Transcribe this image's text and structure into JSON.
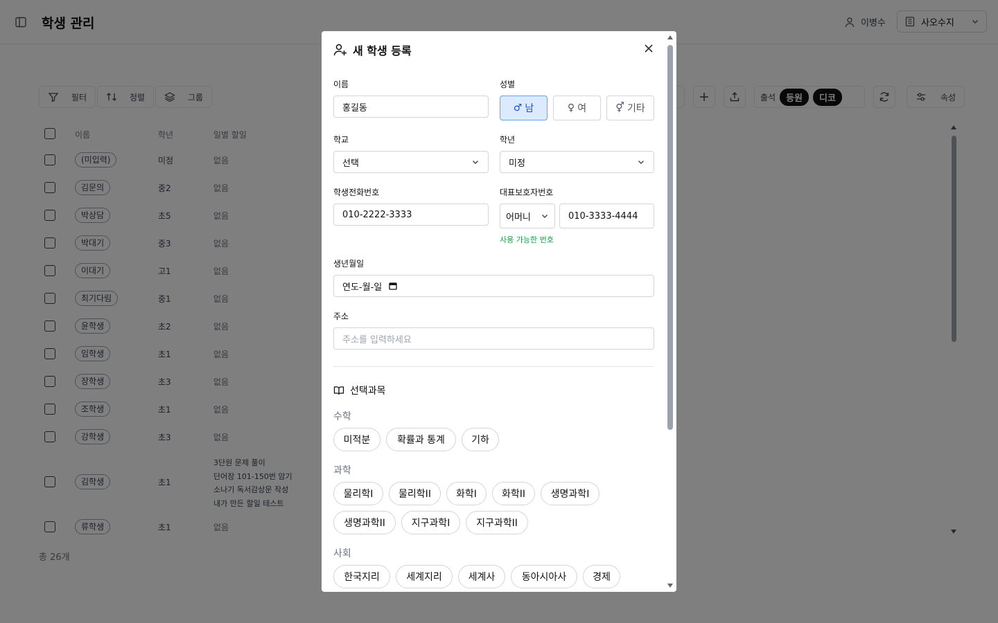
{
  "app": {
    "page_title": "학생 관리",
    "user_name": "이병수",
    "org_name": "사오수지"
  },
  "toolbar": {
    "filter": "필터",
    "sort": "정렬",
    "group": "그룹",
    "attendance": "출석",
    "pill_enroll": "등원",
    "pill_code": "디코",
    "properties": "속성"
  },
  "grid": {
    "headers": {
      "name": "이름",
      "grade": "학년",
      "daily_task": "일별 할일"
    },
    "rows": [
      {
        "name": "(미입력)",
        "grade": "미정",
        "task": "없음"
      },
      {
        "name": "김문의",
        "grade": "중2",
        "task": "없음"
      },
      {
        "name": "박상담",
        "grade": "초5",
        "task": "없음"
      },
      {
        "name": "박대기",
        "grade": "중3",
        "task": "없음"
      },
      {
        "name": "이대기",
        "grade": "고1",
        "task": "없음"
      },
      {
        "name": "최기다림",
        "grade": "중1",
        "task": "없음"
      },
      {
        "name": "윤학생",
        "grade": "초2",
        "task": "없음"
      },
      {
        "name": "임학생",
        "grade": "초1",
        "task": "없음"
      },
      {
        "name": "장학생",
        "grade": "초3",
        "task": "없음"
      },
      {
        "name": "조학생",
        "grade": "초1",
        "task": "없음"
      },
      {
        "name": "강학생",
        "grade": "초3",
        "task": "없음"
      },
      {
        "name": "김학생",
        "grade": "초1",
        "tasks": [
          "3단원 문제 풀이",
          "단어장 101-150번 암기",
          "소나기 독서감상문 작성",
          "내가 만든 할일 테스트"
        ]
      },
      {
        "name": "류학생",
        "grade": "초1",
        "task": "없음"
      }
    ],
    "total": "총 26개"
  },
  "modal": {
    "title": "새 학생 등록",
    "name_label": "이름",
    "name_value": "홍길동",
    "gender_label": "성별",
    "gender_options": [
      "남",
      "여",
      "기타"
    ],
    "school_label": "학교",
    "school_value": "선택",
    "grade_label": "학년",
    "grade_value": "미정",
    "student_phone_label": "학생전화번호",
    "student_phone_value": "010-2222-3333",
    "guardian_phone_label": "대표보호자번호",
    "guardian_relation": "어머니",
    "guardian_phone_value": "010-3333-4444",
    "guardian_phone_status": "사용 가능한 번호",
    "birth_label": "생년월일",
    "birth_value": "연도-월-일",
    "address_label": "주소",
    "address_placeholder": "주소를 입력하세요",
    "electives_title": "선택과목",
    "categories": {
      "math": {
        "label": "수학",
        "items": [
          "미적분",
          "확률과 통계",
          "기하"
        ]
      },
      "science": {
        "label": "과학",
        "items": [
          "물리학I",
          "물리학II",
          "화학I",
          "화학II",
          "생명과학I",
          "생명과학II",
          "지구과학I",
          "지구과학II"
        ]
      },
      "social": {
        "label": "사회",
        "items": [
          "한국지리",
          "세계지리",
          "세계사",
          "동아시아사",
          "경제"
        ]
      }
    }
  }
}
